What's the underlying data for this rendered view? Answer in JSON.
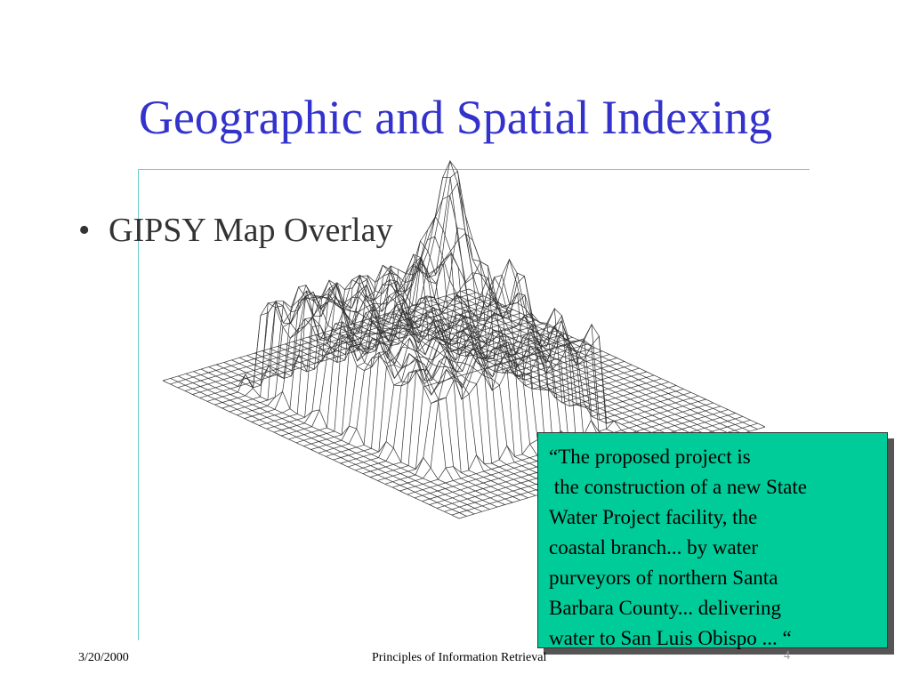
{
  "slide": {
    "title": "Geographic and Spatial Indexing",
    "bullet": "GIPSY Map Overlay",
    "accent_color": "#3333cc",
    "rule_color": "#66cccc"
  },
  "callout": {
    "lines": [
      "“The proposed project is",
      " the construction of a new State",
      "Water Project facility, the",
      "coastal branch... by water",
      "purveyors of northern Santa",
      "Barbara County... delivering",
      "water to San Luis Obispo ... “"
    ],
    "background_color": "#00cc99"
  },
  "footer": {
    "date": "3/20/2000",
    "center": "Principles of Information Retrieval",
    "page": "4"
  }
}
